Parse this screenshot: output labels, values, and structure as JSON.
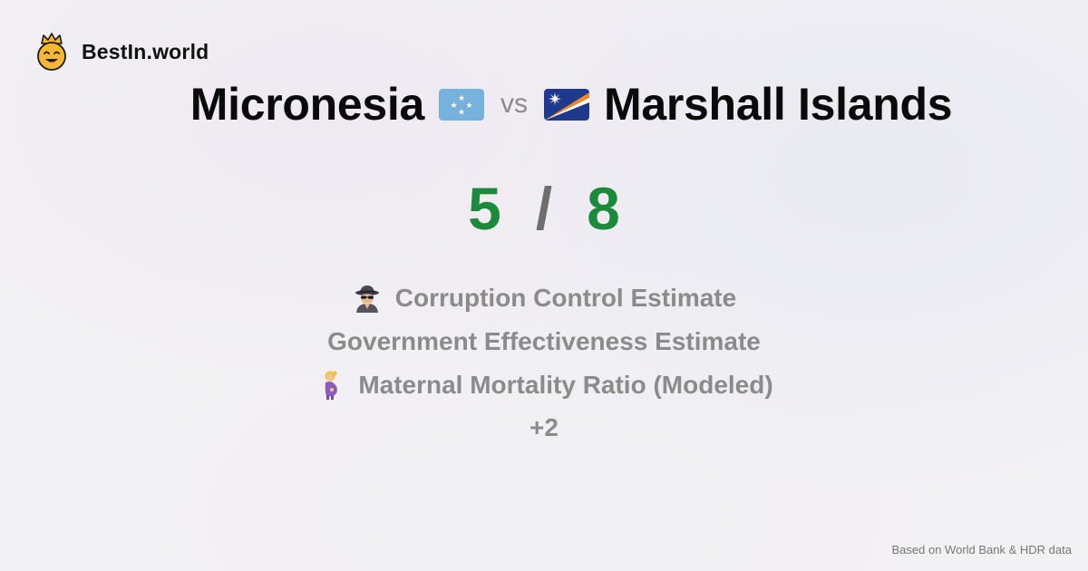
{
  "brand": {
    "name": "BestIn.world",
    "logo_icon": "crowned-smiley-icon"
  },
  "comparison": {
    "country_a": {
      "name": "Micronesia",
      "flag_icon": "micronesia-flag-icon"
    },
    "vs_label": "vs",
    "country_b": {
      "name": "Marshall Islands",
      "flag_icon": "marshall-islands-flag-icon"
    }
  },
  "score": {
    "a": "5",
    "separator": "/",
    "b": "8",
    "color": "#1b8a3a"
  },
  "metrics": [
    {
      "label": "Corruption Control Estimate",
      "icon": "detective-icon"
    },
    {
      "label": "Government Effectiveness Estimate",
      "icon": ""
    },
    {
      "label": "Maternal Mortality Ratio (Modeled)",
      "icon": "pregnant-woman-icon"
    }
  ],
  "more_label": "+2",
  "footer": {
    "source": "Based on World Bank & HDR data"
  }
}
